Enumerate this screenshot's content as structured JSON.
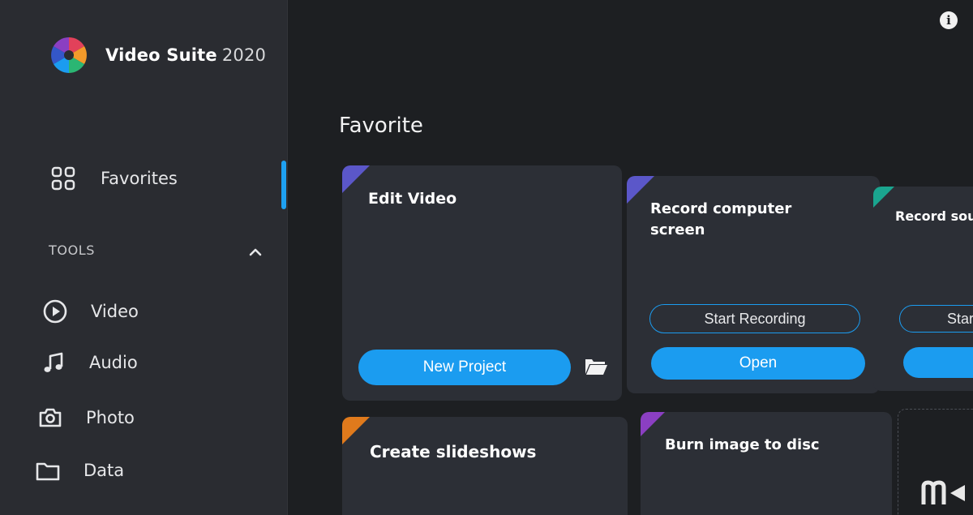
{
  "app": {
    "name": "Video Suite",
    "year": "2020"
  },
  "sidebar": {
    "favorites_label": "Favorites",
    "tools_header": "TOOLS",
    "tools": [
      {
        "label": "Video",
        "icon": "play-circle-icon"
      },
      {
        "label": "Audio",
        "icon": "music-note-icon"
      },
      {
        "label": "Photo",
        "icon": "camera-icon"
      },
      {
        "label": "Data",
        "icon": "folder-icon"
      }
    ]
  },
  "main": {
    "title": "Favorite",
    "cards": [
      {
        "title": "Edit Video",
        "primary_button": "New Project",
        "accent": "#5b57c9"
      },
      {
        "title_line1": "Record computer",
        "title_line2": "screen",
        "outline_button": "Start Recording",
        "primary_button": "Open",
        "accent": "#5b57c9"
      },
      {
        "title": "Record sou",
        "outline_button": "Star",
        "accent": "#1aa58f"
      },
      {
        "title": "Create slideshows",
        "accent": "#e07a1c"
      },
      {
        "title": "Burn image to disc",
        "accent": "#8b3fc2"
      }
    ]
  },
  "colors": {
    "accent_blue": "#1b9cf0",
    "sidebar_bg": "#2a2c31",
    "main_bg": "#1d1f22",
    "card_bg": "#2c2f36"
  }
}
